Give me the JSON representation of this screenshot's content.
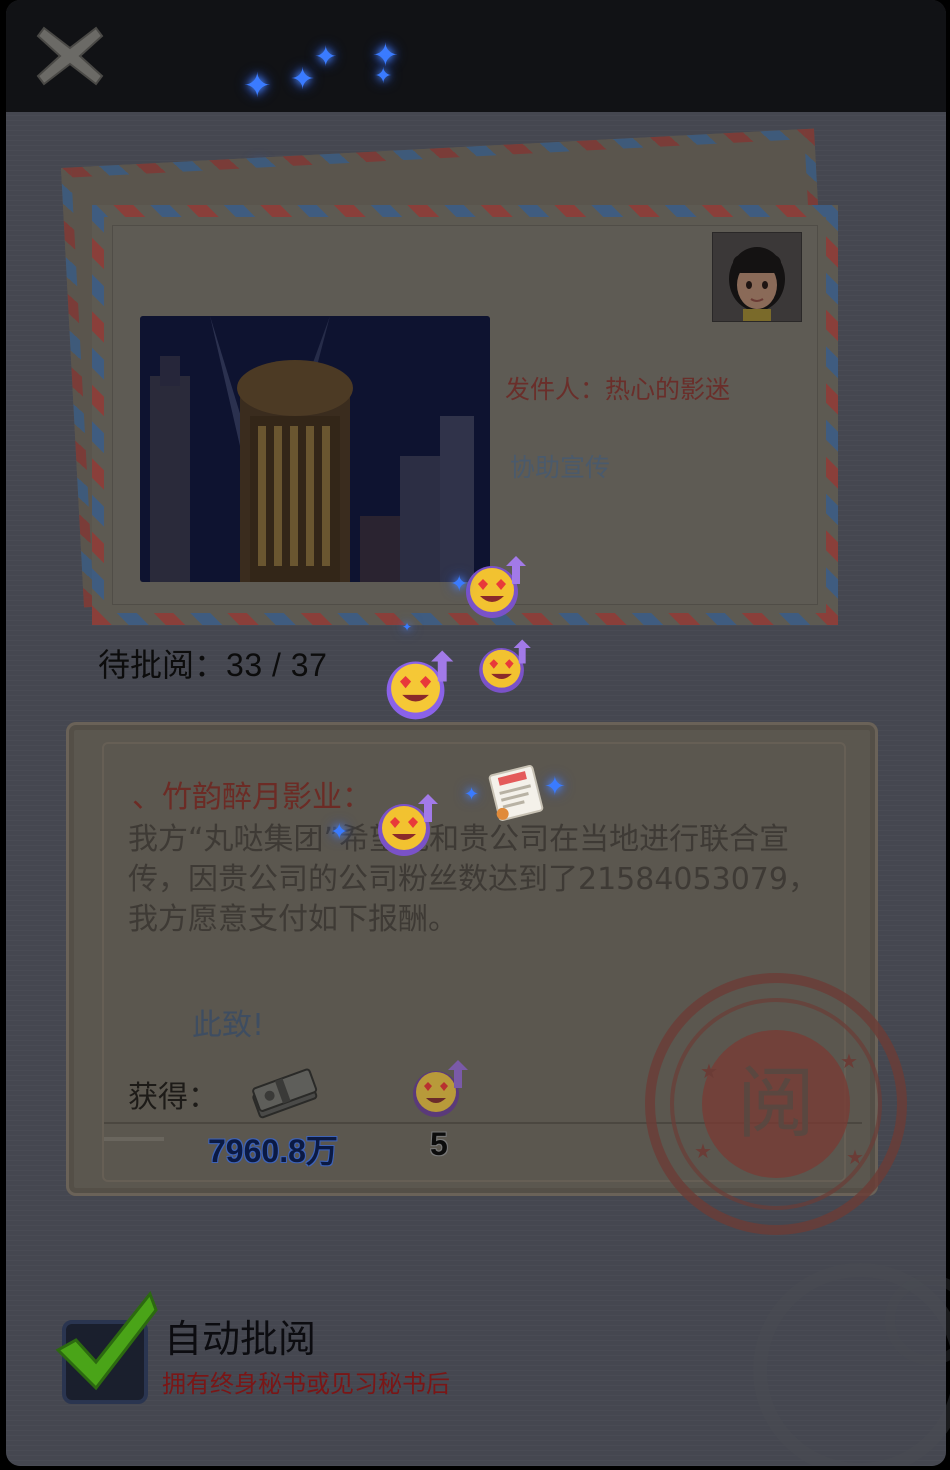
{
  "header": {
    "close_icon": "close-x-icon"
  },
  "envelope": {
    "sender_label": "发件人：热心的影迷",
    "subject": "协助宣传",
    "photo": "night-cinema-building-photo",
    "avatar": "sender-avatar"
  },
  "pending": {
    "label": "待批阅：",
    "value": "33 / 37"
  },
  "letter": {
    "greeting": "、竹韵醉月影业：",
    "body": "我方“丸哒集团”希望能和贵公司在当地进行联合宣传，因贵公司的公司粉丝数达到了21584053079，我方愿意支付如下报酬。",
    "closing": "此致!",
    "reward_label": "获得：",
    "rewards": [
      {
        "icon": "cash-stack-icon",
        "value": "7960.8万"
      },
      {
        "icon": "fan-heart-eyes-icon",
        "value": "5"
      }
    ],
    "stamp_text": "阅"
  },
  "auto_review": {
    "checked": true,
    "label": "自动批阅",
    "hint": "拥有终身秘书或见习秘书后"
  },
  "colors": {
    "sparkle": "#3a7bff",
    "check": "#5cc41c",
    "stamp": "#8b3a34"
  }
}
